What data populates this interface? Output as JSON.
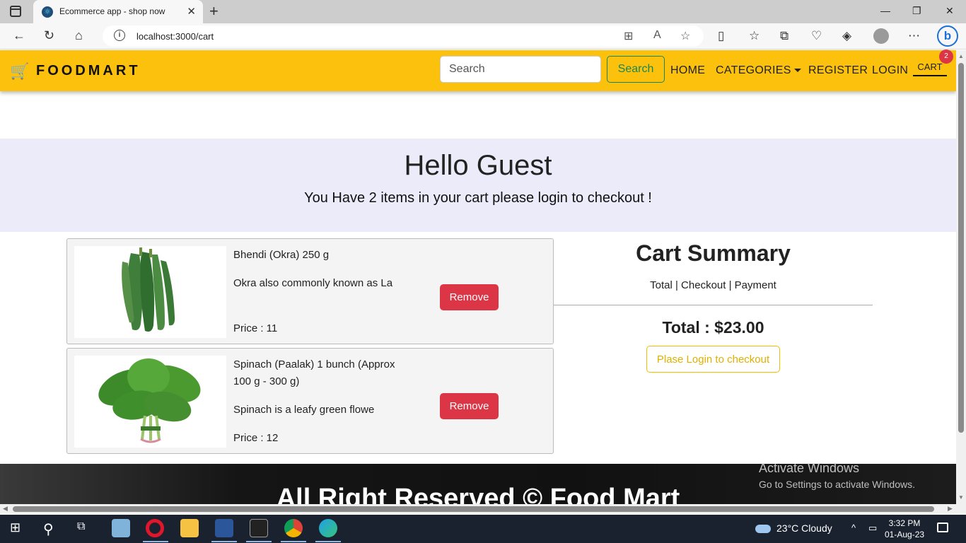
{
  "browser": {
    "tab_title": "Ecommerce app - shop now",
    "url": "localhost:3000/cart"
  },
  "header": {
    "brand": "FOODMART",
    "search_placeholder": "Search",
    "search_button": "Search",
    "nav": {
      "home": "HOME",
      "categories": "CATEGORIES",
      "register": "REGISTER",
      "login": "LOGIN",
      "cart": "CART"
    },
    "cart_count": "2"
  },
  "hero": {
    "title": "Hello Guest",
    "subtitle": "You Have 2 items in your cart please login to checkout !"
  },
  "cart_items": [
    {
      "name": "Bhendi (Okra) 250 g",
      "description": "Okra also commonly known as La",
      "price": "Price : 11",
      "remove": "Remove"
    },
    {
      "name": "Spinach (Paalak) 1 bunch (Approx 100 g - 300 g)",
      "description": "Spinach is a leafy green flowe",
      "price": "Price : 12",
      "remove": "Remove"
    }
  ],
  "summary": {
    "title": "Cart Summary",
    "subtitle": "Total | Checkout | Payment",
    "total": "Total : $23.00",
    "login_button": "Plase Login to checkout"
  },
  "footer": {
    "text": "All Right Reserved © Food Mart"
  },
  "watermark": {
    "line1": "Activate Windows",
    "line2": "Go to Settings to activate Windows."
  },
  "taskbar": {
    "weather": "23°C  Cloudy",
    "time": "3:32 PM",
    "date": "01-Aug-23"
  },
  "colors": {
    "header_bg": "#fcc10d",
    "hero_bg": "#ebebfa",
    "danger": "#dc3545",
    "success": "#198754"
  }
}
